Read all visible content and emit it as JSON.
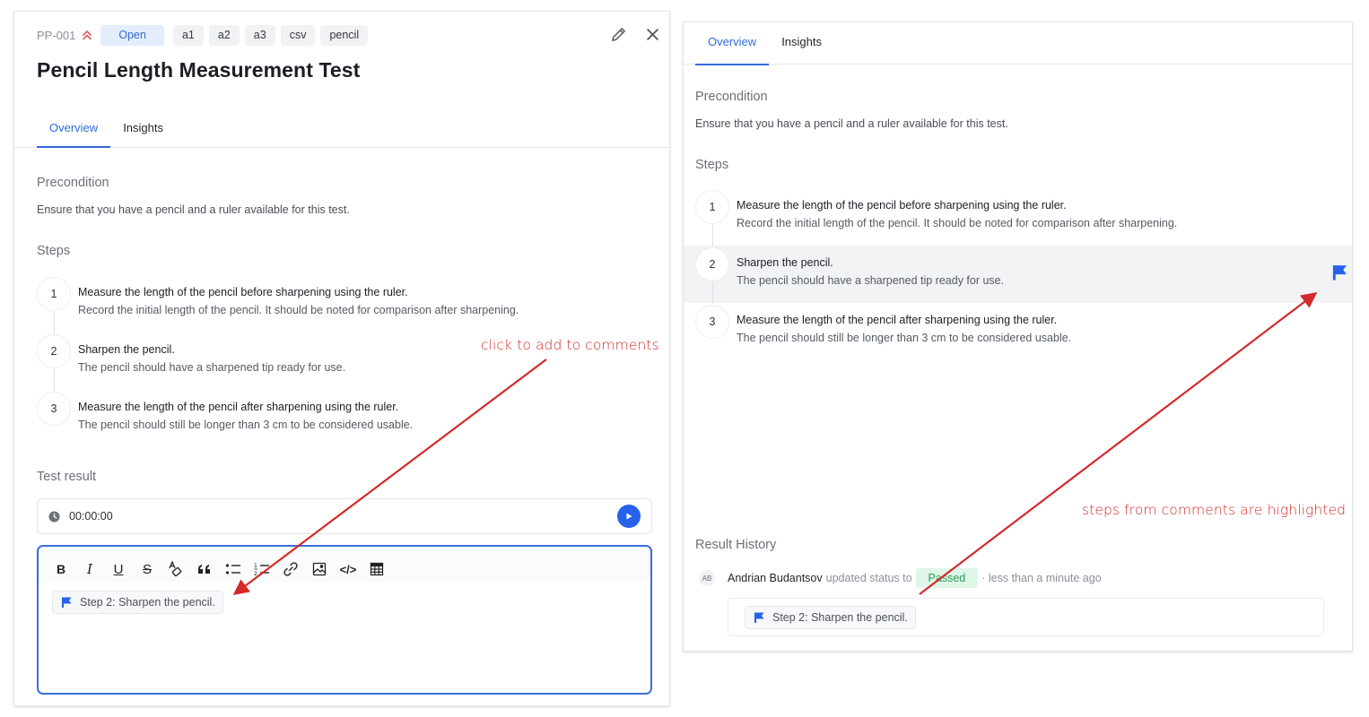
{
  "colors": {
    "accent": "#2f6bd8",
    "play_button": "#2563eb",
    "passed_bg": "#dff5e8",
    "passed_text": "#2a9d5a",
    "annotation": "#d42a2a",
    "priority": "#e05a5a",
    "highlight_row": "#f1f3f5"
  },
  "left_panel": {
    "case_id": "PP-001",
    "priority_icon": "chevrons-up-icon",
    "status": "Open",
    "tags": [
      "a1",
      "a2",
      "a3",
      "csv",
      "pencil"
    ],
    "title": "Pencil Length Measurement Test",
    "actions": {
      "edit_icon": "pencil-icon",
      "close_icon": "close-icon"
    },
    "tabs": [
      {
        "label": "Overview",
        "active": true
      },
      {
        "label": "Insights",
        "active": false
      }
    ],
    "precondition_title": "Precondition",
    "precondition_text": "Ensure that you have a pencil and a ruler available for this test.",
    "steps_title": "Steps",
    "steps": [
      {
        "num": "1",
        "action": "Measure the length of the pencil before sharpening using the ruler.",
        "expected": "Record the initial length of the pencil. It should be noted for comparison after sharpening."
      },
      {
        "num": "2",
        "action": "Sharpen the pencil.",
        "expected": "The pencil should have a sharpened tip ready for use."
      },
      {
        "num": "3",
        "action": "Measure the length of the pencil after sharpening using the ruler.",
        "expected": "The pencil should still be longer than 3 cm to be considered usable."
      }
    ],
    "test_result_title": "Test result",
    "timer": {
      "icon": "clock-icon",
      "value": "00:00:00",
      "play_icon": "play-icon"
    },
    "editor": {
      "toolbar": [
        {
          "name": "bold",
          "glyph": "B"
        },
        {
          "name": "italic",
          "glyph": "I"
        },
        {
          "name": "underline",
          "glyph": "U"
        },
        {
          "name": "strikethrough",
          "glyph": "S"
        },
        {
          "name": "clear-format",
          "glyph": "A"
        },
        {
          "name": "blockquote",
          "glyph": "“"
        },
        {
          "name": "bullet-list",
          "glyph": ""
        },
        {
          "name": "ordered-list",
          "glyph": ""
        },
        {
          "name": "link",
          "glyph": ""
        },
        {
          "name": "image",
          "glyph": ""
        },
        {
          "name": "code",
          "glyph": "</>"
        },
        {
          "name": "table",
          "glyph": ""
        }
      ],
      "step_chip": "Step 2: Sharpen the pencil."
    }
  },
  "right_panel": {
    "tabs": [
      {
        "label": "Overview",
        "active": true
      },
      {
        "label": "Insights",
        "active": false
      }
    ],
    "precondition_title": "Precondition",
    "precondition_text": "Ensure that you have a pencil and a ruler available for this test.",
    "steps_title": "Steps",
    "steps": [
      {
        "num": "1",
        "action": "Measure the length of the pencil before sharpening using the ruler.",
        "expected": "Record the initial length of the pencil. It should be noted for comparison after sharpening.",
        "highlighted": false
      },
      {
        "num": "2",
        "action": "Sharpen the pencil.",
        "expected": "The pencil should have a sharpened tip ready for use.",
        "highlighted": true
      },
      {
        "num": "3",
        "action": "Measure the length of the pencil after sharpening using the ruler.",
        "expected": "The pencil should still be longer than 3 cm to be considered usable.",
        "highlighted": false
      }
    ],
    "result_history": {
      "title": "Result History",
      "avatar_initials": "AB",
      "user": "Andrian Budantsov",
      "action_text": "updated status to",
      "status": "Passed",
      "time_text": "· less than a minute ago",
      "comment_chip": "Step 2: Sharpen the pencil."
    }
  },
  "annotations": {
    "left": "click to add to comments",
    "right": "steps from comments are highlighted"
  }
}
